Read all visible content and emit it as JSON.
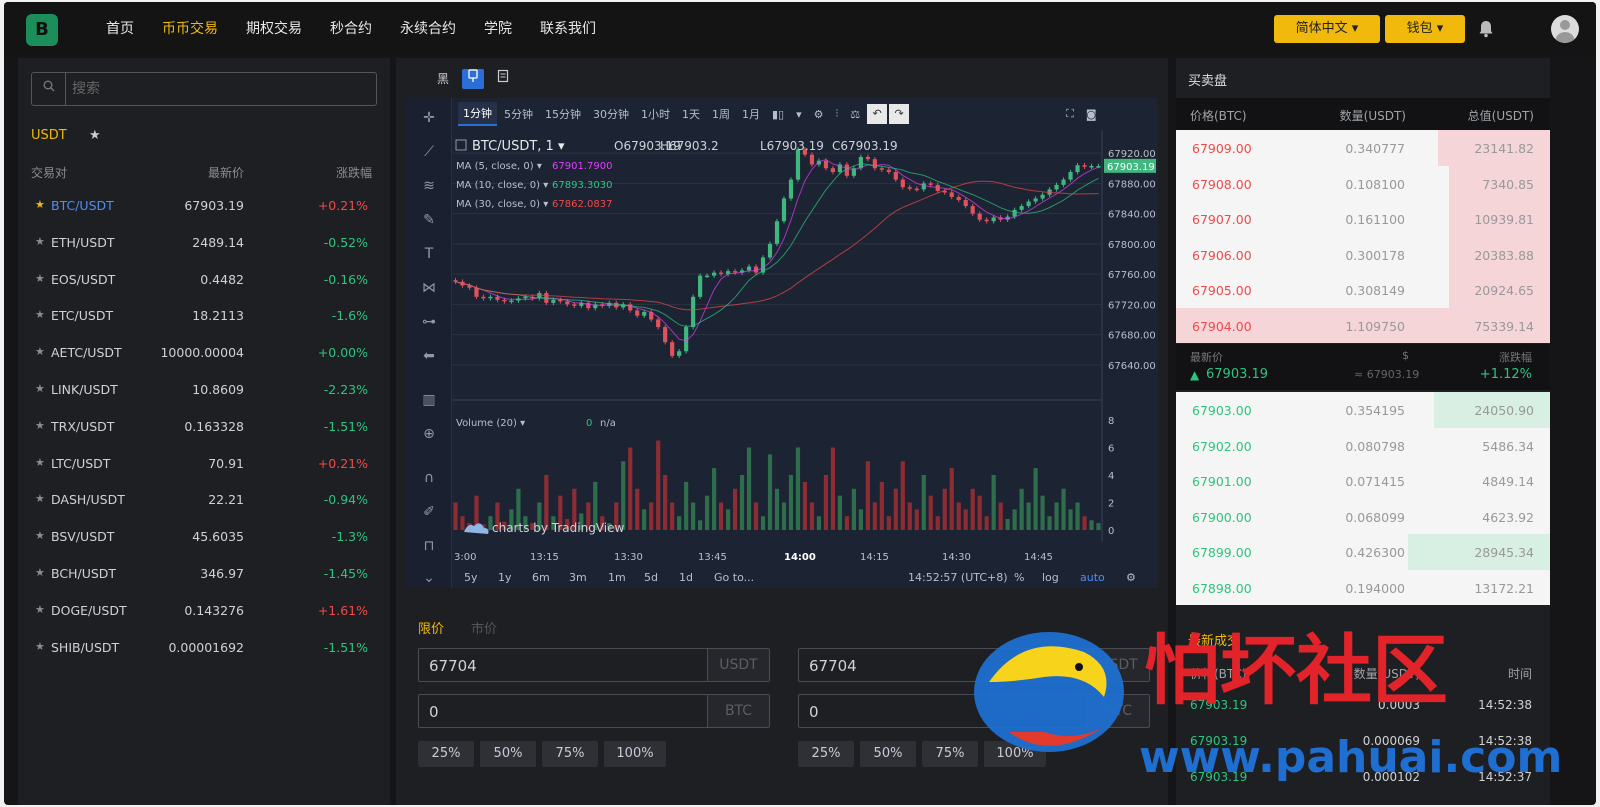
{
  "colors": {
    "accent": "#f0b90b",
    "up": "#f04a4a",
    "down": "#2ec480",
    "selected": "#4f8df7"
  },
  "brand": {
    "logo_letter": "B"
  },
  "nav": {
    "items": [
      "首页",
      "币币交易",
      "期权交易",
      "秒合约",
      "永续合约",
      "学院",
      "联系我们"
    ],
    "active_index": 1
  },
  "header": {
    "language_label": "简体中文 ▾",
    "wallet_label": "钱包 ▾"
  },
  "search": {
    "placeholder": "搜索"
  },
  "market": {
    "quote_tab": "USDT",
    "fav_label": "★",
    "columns": {
      "pair": "交易对",
      "price": "最新价",
      "change": "涨跌幅"
    },
    "rows": [
      {
        "pair": "BTC/USDT",
        "price": "67903.19",
        "change": "+0.21%",
        "dir": "up",
        "selected": true
      },
      {
        "pair": "ETH/USDT",
        "price": "2489.14",
        "change": "-0.52%",
        "dir": "dn"
      },
      {
        "pair": "EOS/USDT",
        "price": "0.4482",
        "change": "-0.16%",
        "dir": "dn"
      },
      {
        "pair": "ETC/USDT",
        "price": "18.2113",
        "change": "-1.6%",
        "dir": "dn"
      },
      {
        "pair": "AETC/USDT",
        "price": "10000.00004",
        "change": "+0.00%",
        "dir": "dn"
      },
      {
        "pair": "LINK/USDT",
        "price": "10.8609",
        "change": "-2.23%",
        "dir": "dn"
      },
      {
        "pair": "TRX/USDT",
        "price": "0.163328",
        "change": "-1.51%",
        "dir": "dn"
      },
      {
        "pair": "LTC/USDT",
        "price": "70.91",
        "change": "+0.21%",
        "dir": "up"
      },
      {
        "pair": "DASH/USDT",
        "price": "22.21",
        "change": "-0.94%",
        "dir": "dn"
      },
      {
        "pair": "BSV/USDT",
        "price": "45.6035",
        "change": "-1.3%",
        "dir": "dn"
      },
      {
        "pair": "BCH/USDT",
        "price": "346.97",
        "change": "-1.45%",
        "dir": "dn"
      },
      {
        "pair": "DOGE/USDT",
        "price": "0.143276",
        "change": "+1.61%",
        "dir": "up"
      },
      {
        "pair": "SHIB/USDT",
        "price": "0.00001692",
        "change": "-1.51%",
        "dir": "dn"
      }
    ]
  },
  "chart_tools": {
    "theme_label": "黑"
  },
  "chart": {
    "intervals": [
      "1分钟",
      "5分钟",
      "15分钟",
      "30分钟",
      "1小时",
      "1天",
      "1周",
      "1月"
    ],
    "active_interval": 0,
    "symbol": "BTC/USDT, 1 ▾",
    "ohlc": {
      "o": "O67903.19",
      "h": "H67903.2",
      "l": "L67903.19",
      "c": "C67903.19"
    },
    "ma_labels": [
      {
        "label": "MA (5, close, 0) ▾",
        "value": "67901.7900",
        "color": "#e040fb"
      },
      {
        "label": "MA (10, close, 0) ▾",
        "value": "67893.3030",
        "color": "#2ec480"
      },
      {
        "label": "MA (30, close, 0) ▾",
        "value": "67862.0837",
        "color": "#f04a4a"
      }
    ],
    "price_axis": [
      "67920.00",
      "67880.00",
      "67840.00",
      "67800.00",
      "67760.00",
      "67720.00",
      "67680.00",
      "67640.00"
    ],
    "last_price_tag": "67903.19",
    "volume_label": "Volume (20) ▾",
    "volume_value": "0",
    "volume_na": "n/a",
    "volume_axis": [
      "8",
      "6",
      "4",
      "2",
      "0"
    ],
    "attribution": "charts by TradingView",
    "time_axis": [
      "3:00",
      "13:15",
      "13:30",
      "13:45",
      "14:00",
      "14:15",
      "14:30",
      "14:45"
    ],
    "ranges": [
      "5y",
      "1y",
      "6m",
      "3m",
      "1m",
      "5d",
      "1d",
      "Go to..."
    ],
    "clock": "14:52:57 (UTC+8)",
    "scale_options": [
      "%",
      "log",
      "auto"
    ]
  },
  "chart_data": {
    "type": "line",
    "title": "BTC/USDT, 1",
    "price_range": [
      67620,
      67940
    ],
    "closes": [
      67750,
      67745,
      67742,
      67730,
      67728,
      67730,
      67726,
      67724,
      67725,
      67728,
      67730,
      67728,
      67735,
      67722,
      67726,
      67724,
      67720,
      67718,
      67722,
      67715,
      67720,
      67718,
      67722,
      67716,
      67720,
      67712,
      67705,
      67710,
      67700,
      67690,
      67670,
      67652,
      67658,
      67690,
      67730,
      67758,
      67758,
      67762,
      67760,
      67764,
      67762,
      67765,
      67770,
      67762,
      67782,
      67800,
      67830,
      67860,
      67885,
      67925,
      67918,
      67905,
      67910,
      67900,
      67895,
      67905,
      67890,
      67900,
      67915,
      67912,
      67900,
      67898,
      67895,
      67885,
      67875,
      67873,
      67872,
      67880,
      67878,
      67870,
      67868,
      67862,
      67858,
      67850,
      67840,
      67832,
      67830,
      67835,
      67832,
      67836,
      67845,
      67850,
      67856,
      67860,
      67865,
      67872,
      67878,
      67885,
      67895,
      67904,
      67902,
      67903,
      67903
    ],
    "volume_range": [
      0,
      8
    ],
    "volumes": [
      2,
      1,
      0.5,
      2.5,
      0.4,
      1,
      2,
      0.6,
      1.5,
      3,
      1,
      0.5,
      2,
      4,
      1,
      2.5,
      0.8,
      3,
      1.2,
      2,
      3.5,
      1,
      0.5,
      2,
      5,
      6,
      3,
      1.5,
      2,
      6.5,
      4,
      2,
      1,
      3.5,
      2,
      0.7,
      2.5,
      4.5,
      2,
      1.5,
      3,
      4,
      6,
      2,
      1,
      5.5,
      3,
      2,
      4,
      6,
      3.5,
      2,
      1,
      4,
      6,
      2.5,
      1,
      3,
      1.5,
      5,
      2,
      3.5,
      1,
      3,
      5,
      2,
      1.5,
      4,
      2.5,
      1,
      3,
      4.5,
      2,
      1.5,
      3,
      2.5,
      1,
      4,
      2,
      0.8,
      1.5,
      3,
      2,
      4.5,
      2.5,
      1,
      2,
      3,
      1.5,
      2,
      1,
      0.7,
      0.5
    ]
  },
  "order_form": {
    "tabs": [
      "限价",
      "市价"
    ],
    "active_tab": 0,
    "buy": {
      "price": "67704",
      "price_unit": "USDT",
      "amount": "0",
      "amount_unit": "BTC"
    },
    "sell": {
      "price": "67704",
      "price_unit": "USDT",
      "amount": "0",
      "amount_unit": "BTC"
    },
    "percents": [
      "25%",
      "50%",
      "75%",
      "100%"
    ]
  },
  "orderbook": {
    "title": "买卖盘",
    "columns": {
      "price": "价格(BTC)",
      "qty": "数量(USDT)",
      "total": "总值(USDT)"
    },
    "asks": [
      {
        "price": "67909.00",
        "qty": "0.340777",
        "total": "23141.82",
        "depth": 0.3
      },
      {
        "price": "67908.00",
        "qty": "0.108100",
        "total": "7340.85",
        "depth": 0.27
      },
      {
        "price": "67907.00",
        "qty": "0.161100",
        "total": "10939.81",
        "depth": 0.27
      },
      {
        "price": "67906.00",
        "qty": "0.300178",
        "total": "20383.88",
        "depth": 0.27
      },
      {
        "price": "67905.00",
        "qty": "0.308149",
        "total": "20924.65",
        "depth": 0.27
      },
      {
        "price": "67904.00",
        "qty": "1.109750",
        "total": "75339.14",
        "depth": 1.0
      }
    ],
    "mid": {
      "label": "最新价",
      "usd_label": "$",
      "change_label": "涨跌幅",
      "price": "67903.19",
      "usd": "≈ 67903.19",
      "change": "+1.12%"
    },
    "bids": [
      {
        "price": "67903.00",
        "qty": "0.354195",
        "total": "24050.90",
        "depth": 0.31
      },
      {
        "price": "67902.00",
        "qty": "0.080798",
        "total": "5486.34",
        "depth": 0.0
      },
      {
        "price": "67901.00",
        "qty": "0.071415",
        "total": "4849.14",
        "depth": 0.0
      },
      {
        "price": "67900.00",
        "qty": "0.068099",
        "total": "4623.92",
        "depth": 0.0
      },
      {
        "price": "67899.00",
        "qty": "0.426300",
        "total": "28945.34",
        "depth": 0.38
      },
      {
        "price": "67898.00",
        "qty": "0.194000",
        "total": "13172.21",
        "depth": 0.0
      }
    ]
  },
  "trades": {
    "title": "最新成交",
    "columns": {
      "price": "价格(BTC)",
      "qty": "数量(USDT)",
      "time": "时间"
    },
    "rows": [
      {
        "price": "67903.19",
        "qty": "0.0003",
        "time": "14:52:38"
      },
      {
        "price": "67903.19",
        "qty": "0.000069",
        "time": "14:52:38"
      },
      {
        "price": "67903.19",
        "qty": "0.000102",
        "time": "14:52:37"
      }
    ]
  },
  "watermark": {
    "text_cn": "怕坏社区",
    "text_url": "www.pahuai.com"
  }
}
